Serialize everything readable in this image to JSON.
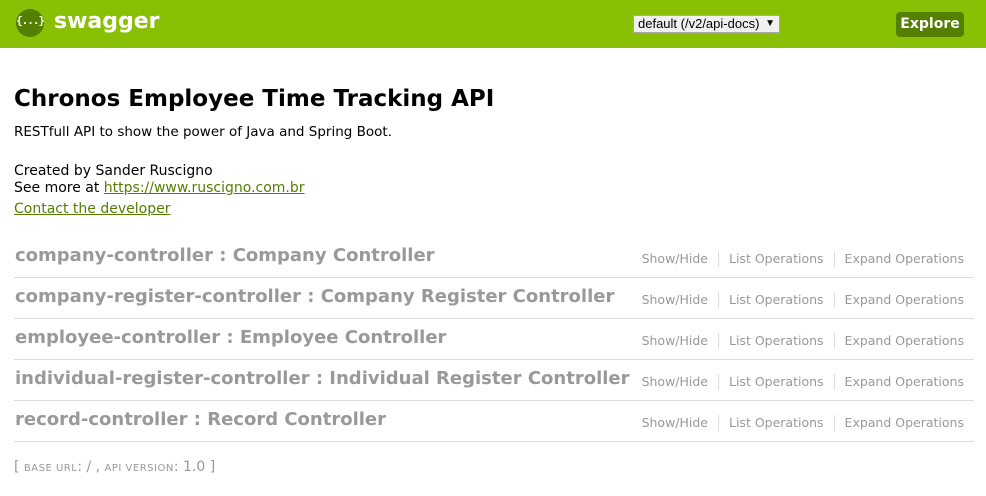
{
  "header": {
    "logo_glyph": "{...}",
    "brand": "swagger",
    "spec_select": {
      "selected": "default (/v2/api-docs)",
      "arrow": "▼"
    },
    "explore_label": "Explore",
    "colors": {
      "bar": "#89bf04",
      "dark": "#547f00"
    }
  },
  "info": {
    "title": "Chronos Employee Time Tracking API",
    "description": "RESTfull API to show the power of Java and Spring Boot.",
    "created_by": "Created by Sander Ruscigno",
    "see_more_prefix": "See more at ",
    "see_more_link": "https://www.ruscigno.com.br",
    "contact_label": "Contact the developer"
  },
  "resources": [
    {
      "name": "company-controller : Company Controller",
      "ops": [
        "Show/Hide",
        "List Operations",
        "Expand Operations"
      ]
    },
    {
      "name": "company-register-controller : Company Register Controller",
      "ops": [
        "Show/Hide",
        "List Operations",
        "Expand Operations"
      ]
    },
    {
      "name": "employee-controller : Employee Controller",
      "ops": [
        "Show/Hide",
        "List Operations",
        "Expand Operations"
      ]
    },
    {
      "name": "individual-register-controller : Individual Register Controller",
      "ops": [
        "Show/Hide",
        "List Operations",
        "Expand Operations"
      ]
    },
    {
      "name": "record-controller : Record Controller",
      "ops": [
        "Show/Hide",
        "List Operations",
        "Expand Operations"
      ]
    }
  ],
  "footer": {
    "open": "[ ",
    "base_url_label": "BASE URL",
    "base_url_value": ": / , ",
    "api_version_label": "API VERSION",
    "api_version_value": ": 1.0 ",
    "close": "]"
  }
}
